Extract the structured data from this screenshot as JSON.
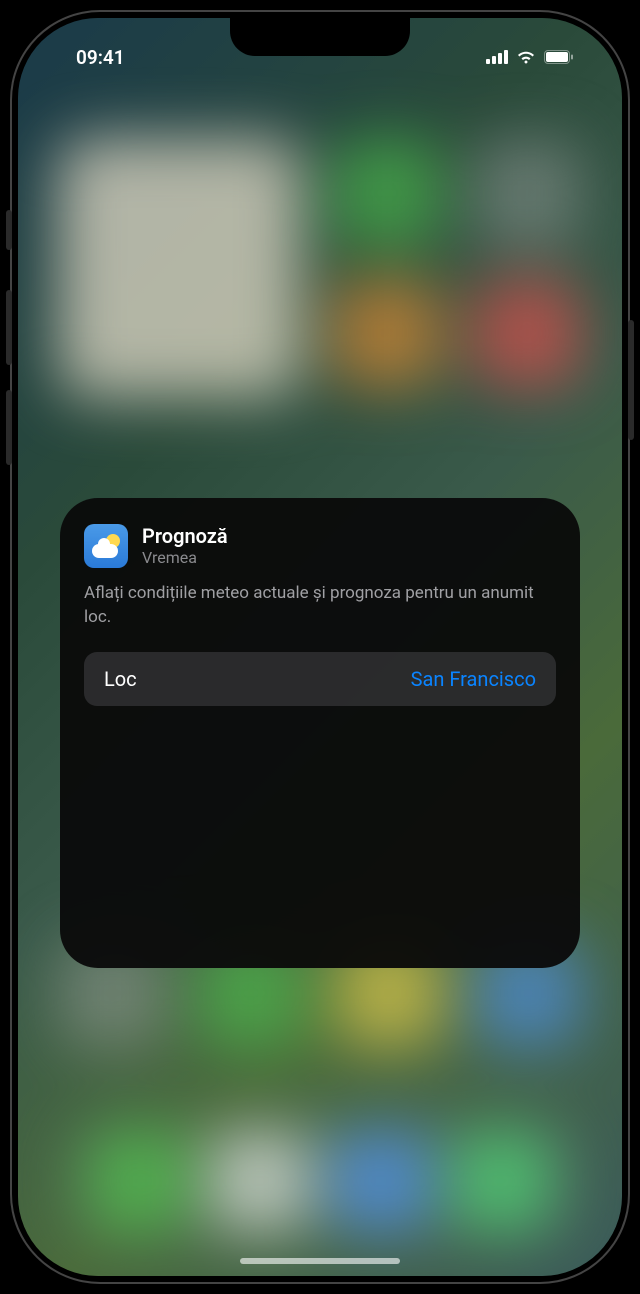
{
  "status_bar": {
    "time": "09:41"
  },
  "popup": {
    "title": "Prognoză",
    "app_name": "Vremea",
    "description": "Aflați condițiile meteo actuale și prognoza pentru un anumit loc.",
    "location_label": "Loc",
    "location_value": "San Francisco"
  }
}
